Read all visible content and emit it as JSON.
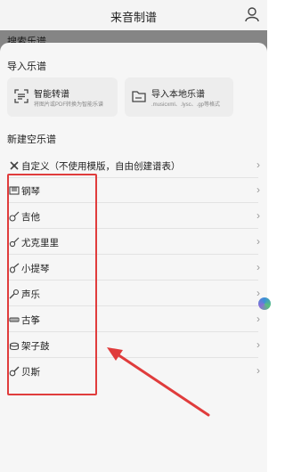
{
  "header": {
    "title": "来音制谱"
  },
  "background": {
    "peek_text": "搜索乐谱"
  },
  "import_section": {
    "title": "导入乐谱",
    "cards": [
      {
        "title": "智能转谱",
        "subtitle": "将图片或PDF转换为智能乐谱",
        "icon": "scan-icon"
      },
      {
        "title": "导入本地乐谱",
        "subtitle": ".musicxml、.lysc、.gp等格式",
        "icon": "folder-icon"
      }
    ]
  },
  "new_section": {
    "title": "新建空乐谱",
    "items": [
      {
        "label": "自定义（不使用模版，自由创建谱表）",
        "icon": "custom-icon"
      },
      {
        "label": "钢琴",
        "icon": "piano-icon"
      },
      {
        "label": "吉他",
        "icon": "guitar-icon"
      },
      {
        "label": "尤克里里",
        "icon": "ukulele-icon"
      },
      {
        "label": "小提琴",
        "icon": "violin-icon"
      },
      {
        "label": "声乐",
        "icon": "microphone-icon"
      },
      {
        "label": "古筝",
        "icon": "guzheng-icon"
      },
      {
        "label": "架子鼓",
        "icon": "drum-icon"
      },
      {
        "label": "贝斯",
        "icon": "bass-icon"
      }
    ],
    "chevron": "›"
  },
  "colors": {
    "accent": "#e03c3c",
    "sheet_bg": "#f6f6f6",
    "card_bg": "#ededed"
  }
}
